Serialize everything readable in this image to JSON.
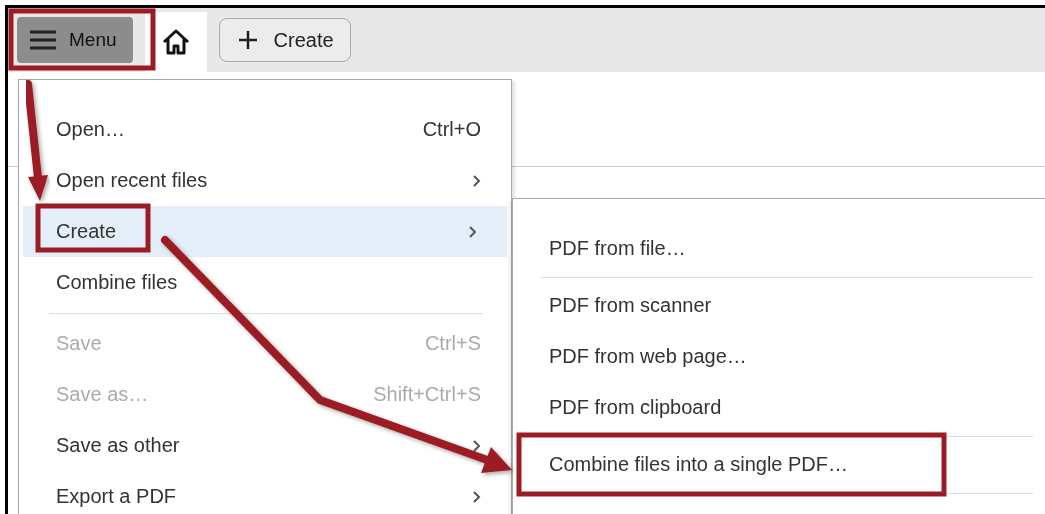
{
  "toolbar": {
    "menu_button": {
      "label": "Menu"
    },
    "home_tab": {
      "selected": true
    },
    "create_button": {
      "label": "Create"
    }
  },
  "menu": {
    "items": [
      {
        "kind": "item",
        "label": "Open…",
        "shortcut": "Ctrl+O",
        "submenu": false,
        "disabled": false,
        "selected": false
      },
      {
        "kind": "item",
        "label": "Open recent files",
        "submenu": true,
        "disabled": false,
        "selected": false
      },
      {
        "kind": "item",
        "label": "Create",
        "submenu": true,
        "disabled": false,
        "selected": true
      },
      {
        "kind": "item",
        "label": "Combine files",
        "submenu": false,
        "disabled": false,
        "selected": false
      },
      {
        "kind": "separator"
      },
      {
        "kind": "item",
        "label": "Save",
        "shortcut": "Ctrl+S",
        "submenu": false,
        "disabled": true,
        "selected": false
      },
      {
        "kind": "item",
        "label": "Save as…",
        "shortcut": "Shift+Ctrl+S",
        "submenu": false,
        "disabled": true,
        "selected": false
      },
      {
        "kind": "item",
        "label": "Save as other",
        "submenu": true,
        "disabled": false,
        "selected": false
      },
      {
        "kind": "item",
        "label": "Export a PDF",
        "submenu": true,
        "disabled": false,
        "selected": false
      }
    ]
  },
  "submenu": {
    "items": [
      {
        "kind": "item",
        "label": "PDF from file…"
      },
      {
        "kind": "separator"
      },
      {
        "kind": "item",
        "label": "PDF from scanner"
      },
      {
        "kind": "item",
        "label": "PDF from web page…"
      },
      {
        "kind": "item",
        "label": "PDF from clipboard"
      },
      {
        "kind": "separator"
      },
      {
        "kind": "item",
        "label": "Combine files into a single PDF…"
      },
      {
        "kind": "separator"
      }
    ]
  }
}
